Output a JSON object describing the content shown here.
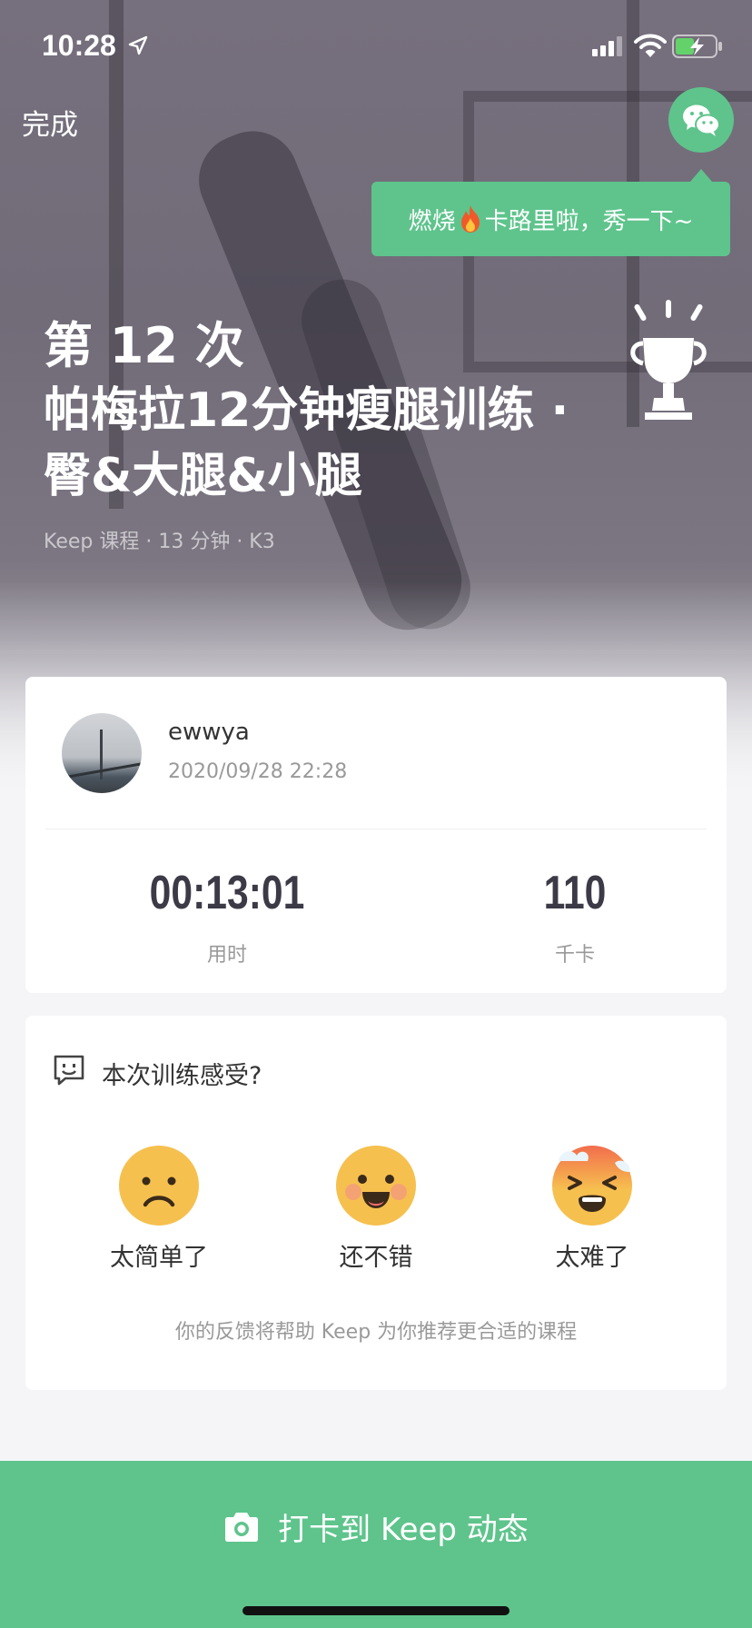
{
  "status_bar": {
    "time": "10:28"
  },
  "top_bar": {
    "done_label": "完成"
  },
  "share_tooltip": {
    "text_before": "燃烧",
    "text_after": "卡路里啦，秀一下~"
  },
  "workout": {
    "count_label": "第 12 次",
    "title": "帕梅拉12分钟瘦腿训练 · 臀&大腿&小腿",
    "meta": "Keep 课程 · 13 分钟 · K3"
  },
  "user": {
    "name": "ewwya",
    "datetime": "2020/09/28 22:28"
  },
  "stats": [
    {
      "value": "00:13:01",
      "label": "用时"
    },
    {
      "value": "110",
      "label": "千卡"
    }
  ],
  "feedback": {
    "title": "本次训练感受?",
    "options": [
      {
        "label": "太简单了",
        "icon": "frown-face-icon"
      },
      {
        "label": "还不错",
        "icon": "smile-face-icon"
      },
      {
        "label": "太难了",
        "icon": "exhausted-face-icon"
      }
    ],
    "note": "你的反馈将帮助 Keep 为你推荐更合适的课程"
  },
  "checkin_button": {
    "label": "打卡到 Keep 动态"
  },
  "colors": {
    "accent": "#5ec48c",
    "face_yellow": "#f6c04f",
    "stat_text": "#3d3a47"
  }
}
